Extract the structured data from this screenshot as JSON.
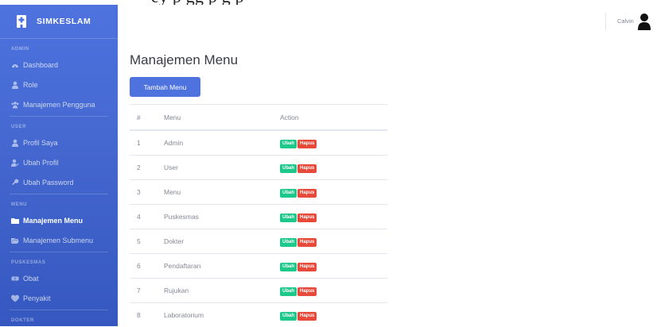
{
  "document_fragment": "ey                              p                  gg                  p                g                        p",
  "brand": {
    "name": "SIMKESLAM"
  },
  "sidebar": {
    "sections": [
      {
        "heading": "ADMIN",
        "items": [
          {
            "label": "Dashboard",
            "icon": "dashboard-icon"
          },
          {
            "label": "Role",
            "icon": "user-icon"
          },
          {
            "label": "Manajemen Pengguna",
            "icon": "users-icon"
          }
        ]
      },
      {
        "heading": "USER",
        "items": [
          {
            "label": "Profil Saya",
            "icon": "user-icon"
          },
          {
            "label": "Ubah Profil",
            "icon": "user-edit-icon"
          },
          {
            "label": "Ubah Password",
            "icon": "key-icon"
          }
        ]
      },
      {
        "heading": "MENU",
        "items": [
          {
            "label": "Manajemen Menu",
            "icon": "folder-icon",
            "active": true
          },
          {
            "label": "Manajemen Submenu",
            "icon": "folder-open-icon"
          }
        ]
      },
      {
        "heading": "PUSKESMAS",
        "items": [
          {
            "label": "Obat",
            "icon": "capsule-icon"
          },
          {
            "label": "Penyakit",
            "icon": "virus-icon"
          }
        ]
      },
      {
        "heading": "DOKTER",
        "items": []
      }
    ]
  },
  "topbar": {
    "user_name": "Calvin"
  },
  "main": {
    "title": "Manajemen Menu",
    "add_button": "Tambah Menu",
    "table": {
      "headers": [
        "#",
        "Menu",
        "Action"
      ],
      "rows": [
        {
          "num": "1",
          "menu": "Admin"
        },
        {
          "num": "2",
          "menu": "User"
        },
        {
          "num": "3",
          "menu": "Menu"
        },
        {
          "num": "4",
          "menu": "Puskesmas"
        },
        {
          "num": "5",
          "menu": "Dokter"
        },
        {
          "num": "6",
          "menu": "Pendaftaran"
        },
        {
          "num": "7",
          "menu": "Rujukan"
        },
        {
          "num": "8",
          "menu": "Laboratorium"
        }
      ],
      "action_edit": "Ubah",
      "action_delete": "Hapus"
    }
  },
  "colors": {
    "primary": "#4e73df",
    "success": "#1cc88a",
    "danger": "#e74a3b"
  }
}
